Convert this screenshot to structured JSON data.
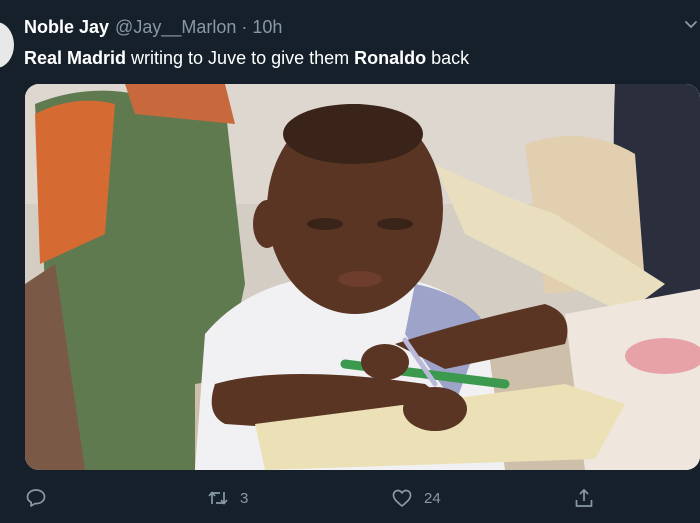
{
  "author": {
    "display_name": "Noble Jay",
    "handle": "@Jay__Marlon",
    "separator": "·",
    "time": "10h"
  },
  "tweet": {
    "segments": [
      {
        "text": "Real Madrid",
        "bold": true
      },
      {
        "text": " writing to Juve to give them ",
        "bold": false
      },
      {
        "text": "Ronaldo",
        "bold": true
      },
      {
        "text": " back",
        "bold": false
      }
    ]
  },
  "media": {
    "kind": "photo"
  },
  "actions": {
    "reply": {
      "icon": "reply-icon",
      "count": ""
    },
    "retweet": {
      "icon": "retweet-icon",
      "count": "3"
    },
    "like": {
      "icon": "heart-icon",
      "count": "24"
    },
    "share": {
      "icon": "share-icon",
      "count": ""
    }
  },
  "colors": {
    "background": "#15202b",
    "text": "#ffffff",
    "secondary_text": "#8899a6"
  }
}
